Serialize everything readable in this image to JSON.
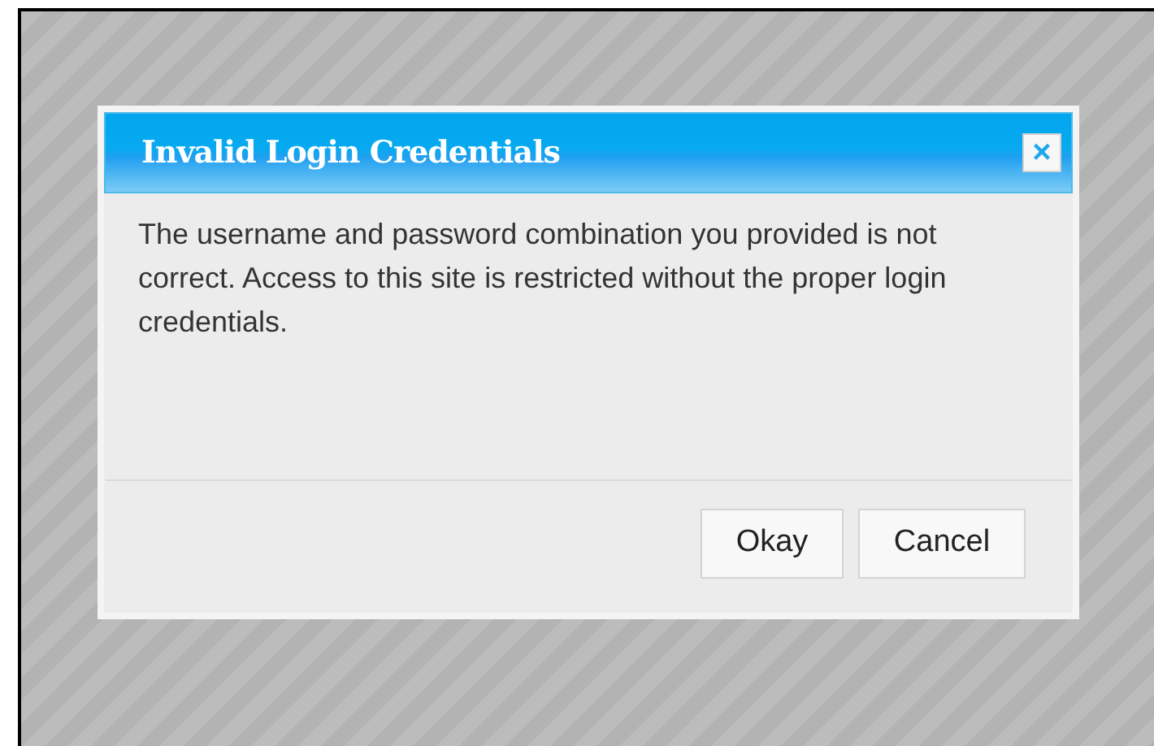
{
  "dialog": {
    "title": "Invalid Login Credentials",
    "close": "×",
    "message": "The username and password combination you provided is not correct. Access to this site is restricted without the proper login credentials.",
    "buttons": [
      "Okay",
      "Cancel"
    ]
  }
}
